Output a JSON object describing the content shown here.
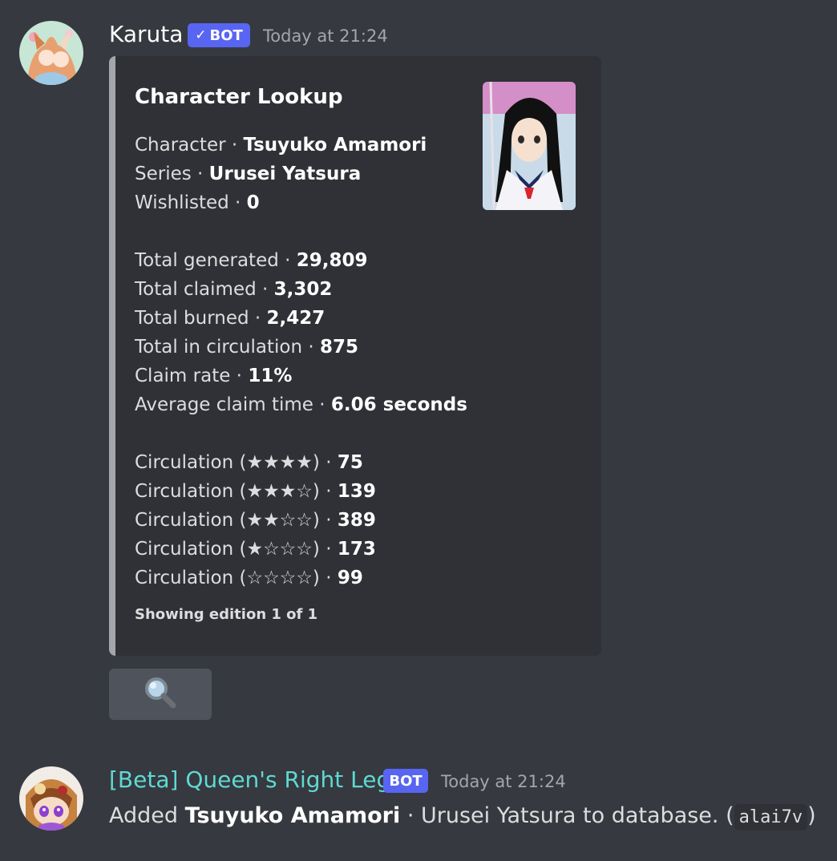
{
  "colors": {
    "background": "#36393f",
    "embed_bg": "#2f3136",
    "embed_border": "#a3a6aa",
    "bot_tag": "#5865f2",
    "queen_name": "#5fd9d3",
    "button_bg": "#4f545c"
  },
  "message1": {
    "author": "Karuta",
    "bot_tag": "BOT",
    "verified_icon": "checkmark-icon",
    "timestamp": "Today at 21:24",
    "embed": {
      "title": "Character Lookup",
      "fields": [
        {
          "label": "Character · ",
          "value": "Tsuyuko Amamori"
        },
        {
          "label": "Series · ",
          "value": "Urusei Yatsura"
        },
        {
          "label": "Wishlisted · ",
          "value": "0"
        }
      ],
      "stats": [
        {
          "label": "Total generated · ",
          "value": "29,809"
        },
        {
          "label": "Total claimed · ",
          "value": "3,302"
        },
        {
          "label": "Total burned · ",
          "value": "2,427"
        },
        {
          "label": "Total in circulation · ",
          "value": "875"
        },
        {
          "label": "Claim rate · ",
          "value": "11%"
        },
        {
          "label": "Average claim time · ",
          "value": "6.06 seconds"
        }
      ],
      "circulation": [
        {
          "label": "Circulation (★★★★) · ",
          "value": "75"
        },
        {
          "label": "Circulation (★★★☆) · ",
          "value": "139"
        },
        {
          "label": "Circulation (★★☆☆) · ",
          "value": "389"
        },
        {
          "label": "Circulation (★☆☆☆) · ",
          "value": "173"
        },
        {
          "label": "Circulation (☆☆☆☆) · ",
          "value": "99"
        }
      ],
      "footer": "Showing edition 1 of 1"
    },
    "button_icon": "magnifying-glass-icon"
  },
  "message2": {
    "author": "[Beta] Queen's Right Leg",
    "bot_tag": "BOT",
    "timestamp": "Today at 21:24",
    "text_prefix": "Added ",
    "text_bold": "Tsuyuko Amamori",
    "text_middle": " · Urusei Yatsura to database. (",
    "code": "alai7v",
    "text_suffix": ")"
  }
}
